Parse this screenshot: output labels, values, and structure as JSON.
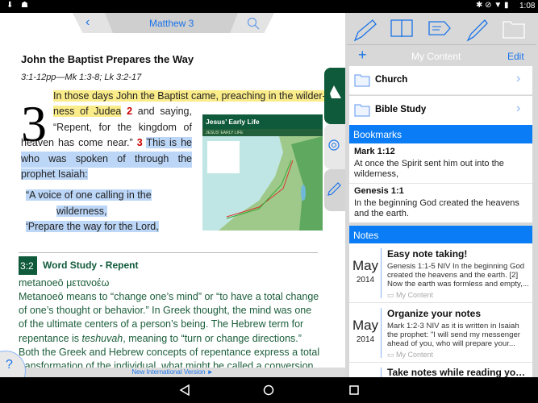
{
  "status": {
    "time": "1:08"
  },
  "reader": {
    "title": "Matthew 3",
    "heading": "John the Baptist Prepares the Way",
    "crossref": "3:1-12pp—Mk 1:3-8; Lk 3:2-17",
    "chapter": "3",
    "v1a": "In those days John the Baptist came, preaching in the wilder-",
    "v1b": "ness of Judea",
    "v2num": "2",
    "v2a": " and saying,",
    "v2b": "“Repent, for the kingdom of",
    "v2c": "heaven has come near.”",
    "v3num": "3",
    "v3a": "This is he",
    "v3b": "who was spoken of through the",
    "v3c": "prophet Isaiah:",
    "poem1": "“A voice of one calling in the",
    "poem2": "wilderness,",
    "poem3": "‘Prepare the way for the Lord,",
    "map_title": "Jesus’ Early Life",
    "map_sub": "JESUS' EARLY LIFE",
    "study_badge": "3:2",
    "study_title": "Word Study - Repent",
    "study_words": "metanoeō   μετανοέω",
    "study_text_1": "Metanoeō means to “change one’s mind” or “to have a total change of one’s thought or behavior.” In Greek thought, the mind was one of the ultimate centers of a person’s being. The Hebrew term for repentance is ",
    "study_text_em": "teshuvah",
    "study_text_2": ", meaning to “turn or change directions.” Both the Greek and Hebrew concepts of repentance express a total transformation of the individual, what might be called a conversion",
    "version": "New International Version ►",
    "help": "?"
  },
  "content": {
    "title": "My Content",
    "add": "+",
    "edit": "Edit",
    "folders": [
      {
        "label": "Church"
      },
      {
        "label": "Bible Study"
      }
    ],
    "bookmarks_header": "Bookmarks",
    "bookmarks": [
      {
        "ref": "Mark 1:12",
        "text": "At once the Spirit sent him out into the wilderness,"
      },
      {
        "ref": "Genesis 1:1",
        "text": "In the beginning God created the heavens and the earth."
      }
    ],
    "notes_header": "Notes",
    "notes": [
      {
        "month": "May",
        "year": "2014",
        "title": "Easy note taking!",
        "body": "Genesis 1:1-5 NIV In the beginning God created the heavens and the earth. [2] Now the earth was formless and empty,...",
        "folder": "My Content"
      },
      {
        "month": "May",
        "year": "2014",
        "title": "Organize your notes",
        "body": "Mark 1:2-3 NIV as it is written in Isaiah the prophet:  \"I will send my messenger ahead of you, who will prepare your...",
        "folder": "My Content"
      },
      {
        "month": "",
        "year": "",
        "title": "Take notes while reading your Bible",
        "body": "",
        "folder": ""
      }
    ]
  },
  "colors": {
    "accent": "#1a73e8",
    "section": "#0a7cf5",
    "green": "#0f5a3a"
  }
}
